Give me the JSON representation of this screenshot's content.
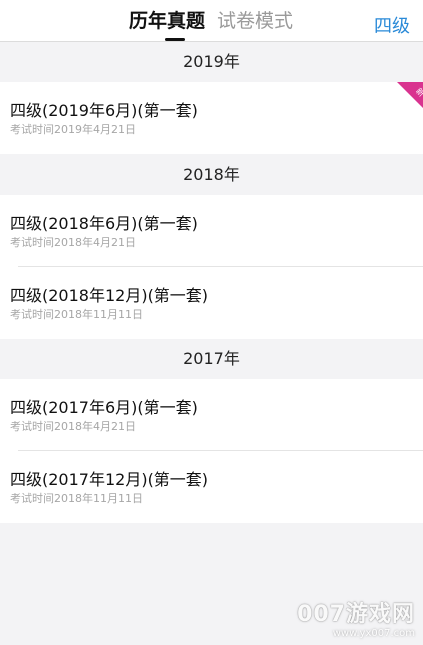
{
  "header": {
    "tabs": [
      {
        "label": "历年真题",
        "active": true
      },
      {
        "label": "试卷模式",
        "active": false
      }
    ],
    "level_label": "四级"
  },
  "sections": [
    {
      "year": "2019年",
      "items": [
        {
          "title": "四级(2019年6月)(第一套)",
          "subtitle": "考试时间2019年4月21日",
          "badge": "新"
        }
      ]
    },
    {
      "year": "2018年",
      "items": [
        {
          "title": "四级(2018年6月)(第一套)",
          "subtitle": "考试时间2018年4月21日"
        },
        {
          "title": "四级(2018年12月)(第一套)",
          "subtitle": "考试时间2018年11月11日"
        }
      ]
    },
    {
      "year": "2017年",
      "items": [
        {
          "title": "四级(2017年6月)(第一套)",
          "subtitle": "考试时间2018年4月21日"
        },
        {
          "title": "四级(2017年12月)(第一套)",
          "subtitle": "考试时间2018年11月11日"
        }
      ]
    }
  ],
  "watermark": {
    "logo": "007游戏网",
    "url": "www.yx007.com"
  },
  "colors": {
    "accent": "#2a8ad8",
    "badge": "#d9338f",
    "background": "#f3f3f5"
  }
}
